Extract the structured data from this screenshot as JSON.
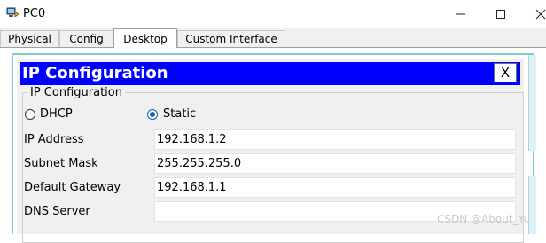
{
  "window": {
    "title": "PC0",
    "minimize_icon": "minimize-icon",
    "maximize_icon": "maximize-icon",
    "close_icon": "close-icon"
  },
  "tabs": [
    {
      "label": "Physical",
      "active": false
    },
    {
      "label": "Config",
      "active": false
    },
    {
      "label": "Desktop",
      "active": true
    },
    {
      "label": "Custom Interface",
      "active": false
    }
  ],
  "ip_config": {
    "header_title": "IP Configuration",
    "close_label": "X",
    "group_label": "IP Configuration",
    "mode_options": [
      {
        "label": "DHCP",
        "selected": false
      },
      {
        "label": "Static",
        "selected": true
      }
    ],
    "fields": [
      {
        "label": "IP Address",
        "value": "192.168.1.2"
      },
      {
        "label": "Subnet Mask",
        "value": "255.255.255.0"
      },
      {
        "label": "Default Gateway",
        "value": "192.168.1.1"
      },
      {
        "label": "DNS Server",
        "value": ""
      }
    ]
  },
  "watermark": "CSDN @About_Yu",
  "colors": {
    "header_bg": "#0000ff",
    "header_text": "#ffffff",
    "radio_accent": "#0a5fb4",
    "frame_border": "#7ecbd8"
  }
}
